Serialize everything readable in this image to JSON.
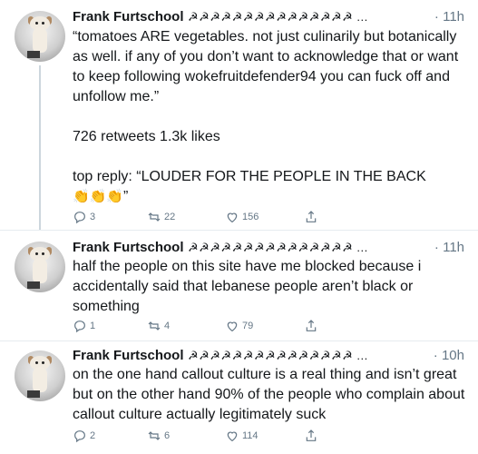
{
  "tweets": [
    {
      "name": "Frank Furtschool",
      "glyphs": "☭☭☭☭☭☭☭☭☭☭☭☭☭☭☭ ...",
      "time": "· 11h",
      "paragraphs": [
        "“tomatoes ARE vegetables. not just culinarily but botanically as well. if any of you don’t want to acknowledge that or want to keep following wokefruitdefender94 you can fuck off and unfollow me.”",
        "726 retweets 1.3k likes",
        "top reply: “LOUDER FOR THE PEOPLE IN THE BACK"
      ],
      "reply_tail": "”",
      "claps": "👏👏👏",
      "replies": "3",
      "retweets": "22",
      "likes": "156"
    },
    {
      "name": "Frank Furtschool",
      "glyphs": "☭☭☭☭☭☭☭☭☭☭☭☭☭☭☭ ...",
      "time": "· 11h",
      "text": "half the people on this site have me blocked because i accidentally said that lebanese people aren’t black or something",
      "replies": "1",
      "retweets": "4",
      "likes": "79"
    },
    {
      "name": "Frank Furtschool",
      "glyphs": "☭☭☭☭☭☭☭☭☭☭☭☭☭☭☭ ...",
      "time": "· 10h",
      "text": "on the one hand callout culture is a real thing and isn’t great but on the other hand 90% of the people who complain about callout culture actually legitimately suck",
      "replies": "2",
      "retweets": "6",
      "likes": "114"
    }
  ],
  "colors": {
    "text": "#14171a",
    "muted": "#657786",
    "divider": "#e6ecf0",
    "thread": "#ccd6dd"
  },
  "icons": [
    "reply-icon",
    "retweet-icon",
    "heart-icon",
    "share-icon"
  ]
}
